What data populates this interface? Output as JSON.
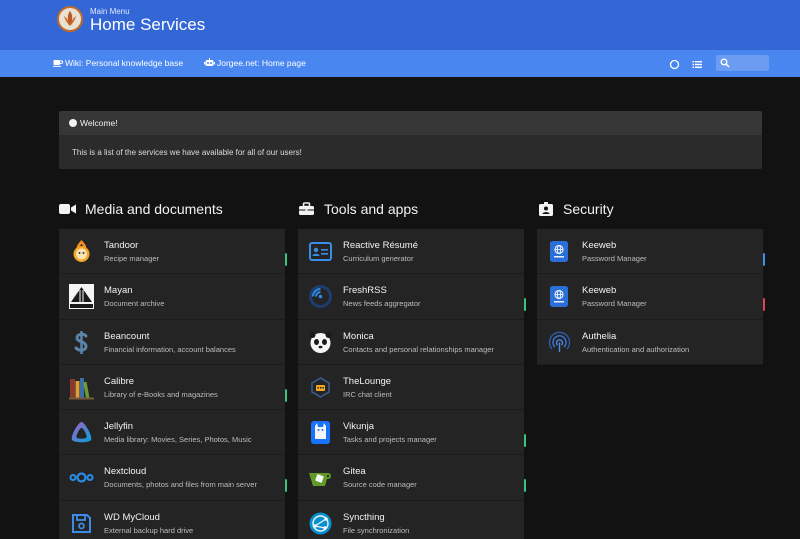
{
  "header": {
    "subtitle": "Main Menu",
    "title": "Home Services"
  },
  "navbar": {
    "links": [
      {
        "label": "Wiki: Personal knowledge base",
        "icon": "coffee-icon"
      },
      {
        "label": "Jorgee.net: Home page",
        "icon": "robot-icon"
      }
    ],
    "search_placeholder": ""
  },
  "welcome": {
    "title": "Welcome!",
    "message": "This is a list of the services we have available for all of our users!"
  },
  "columns": [
    {
      "title": "Media and documents",
      "items": [
        {
          "name": "Tandoor",
          "subtitle": "Recipe manager",
          "status": "#37c47e"
        },
        {
          "name": "Mayan",
          "subtitle": "Document archive",
          "status": ""
        },
        {
          "name": "Beancount",
          "subtitle": "Financial information, account balances",
          "status": ""
        },
        {
          "name": "Calibre",
          "subtitle": "Library of e-Books and magazines",
          "status": "#37c47e"
        },
        {
          "name": "Jellyfin",
          "subtitle": "Media library: Movies, Series, Photos, Music",
          "status": ""
        },
        {
          "name": "Nextcloud",
          "subtitle": "Documents, photos and files from main server",
          "status": "#37c47e"
        },
        {
          "name": "WD MyCloud",
          "subtitle": "External backup hard drive",
          "status": ""
        }
      ]
    },
    {
      "title": "Tools and apps",
      "items": [
        {
          "name": "Reactive Résumé",
          "subtitle": "Curriculum generator",
          "status": ""
        },
        {
          "name": "FreshRSS",
          "subtitle": "News feeds aggregator",
          "status": "#37c47e"
        },
        {
          "name": "Monica",
          "subtitle": "Contacts and personal relationships manager",
          "status": ""
        },
        {
          "name": "TheLounge",
          "subtitle": "IRC chat client",
          "status": ""
        },
        {
          "name": "Vikunja",
          "subtitle": "Tasks and projects manager",
          "status": "#37c47e"
        },
        {
          "name": "Gitea",
          "subtitle": "Source code manager",
          "status": "#37c47e"
        },
        {
          "name": "Syncthing",
          "subtitle": "File synchronization",
          "status": ""
        }
      ]
    },
    {
      "title": "Security",
      "items": [
        {
          "name": "Keeweb",
          "subtitle": "Password Manager",
          "status": "#3b8fe8"
        },
        {
          "name": "Keeweb",
          "subtitle": "Password Manager",
          "status": "#e0434f"
        },
        {
          "name": "Authelia",
          "subtitle": "Authentication and authorization",
          "status": ""
        }
      ]
    }
  ],
  "colors": {
    "header": "#3367d6",
    "navbar": "#4a86f0",
    "background": "#121212",
    "card": "#242424",
    "status_online": "#37c47e",
    "status_info": "#3b8fe8",
    "status_error": "#e0434f"
  }
}
